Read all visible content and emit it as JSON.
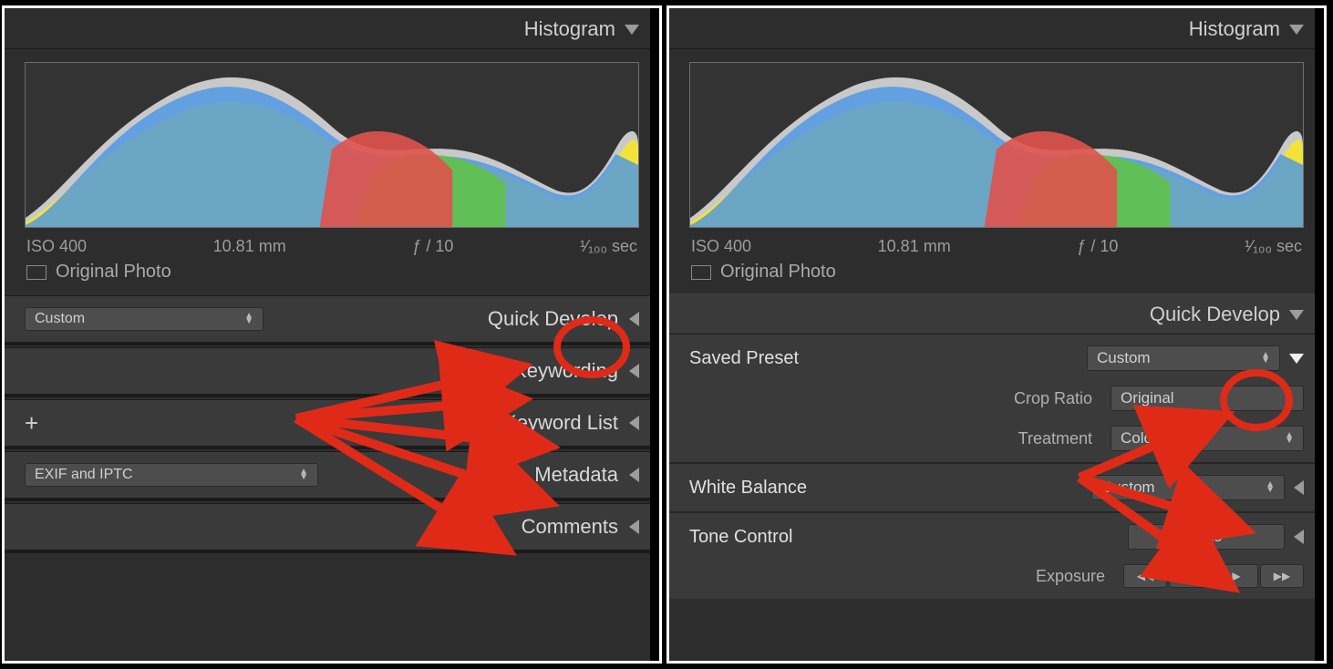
{
  "histogram_panel": {
    "title": "Histogram",
    "meta": {
      "iso": "ISO 400",
      "focal": "10.81 mm",
      "aperture": "ƒ / 10",
      "shutter": "¹⁄₁₀₀ sec"
    },
    "original_photo_label": "Original Photo",
    "original_photo_checked": false
  },
  "left_panel_sections": {
    "quick_develop": {
      "label": "Quick Develop",
      "collapsed": true,
      "preset_value": "Custom"
    },
    "keywording": {
      "label": "Keywording",
      "collapsed": true
    },
    "keyword_list": {
      "label": "Keyword List",
      "collapsed": true
    },
    "metadata": {
      "label": "Metadata",
      "collapsed": true,
      "dropdown_value": "EXIF and IPTC"
    },
    "comments": {
      "label": "Comments",
      "collapsed": true
    }
  },
  "right_panel_quick_develop": {
    "title": "Quick Develop",
    "saved_preset": {
      "label": "Saved Preset",
      "value": "Custom"
    },
    "crop_ratio": {
      "label": "Crop Ratio",
      "value": "Original"
    },
    "treatment": {
      "label": "Treatment",
      "value": "Color"
    },
    "white_balance": {
      "label": "White Balance",
      "value": "Custom"
    },
    "tone_control": {
      "label": "Tone Control",
      "button": "Auto"
    },
    "exposure": {
      "label": "Exposure"
    }
  },
  "annotations": {
    "color": "#e02a18",
    "left_circle_target": "quick-develop-disclosure",
    "right_circle_target": "saved-preset-disclosure",
    "left_arrows_origin": "center-left-panel",
    "left_arrows_targets": [
      "quick-develop",
      "keywording",
      "keyword-list",
      "metadata",
      "comments"
    ],
    "right_arrows_origin": "saved-preset-disclosure",
    "right_arrows_targets": [
      "white-balance-row",
      "tone-control-row"
    ]
  }
}
